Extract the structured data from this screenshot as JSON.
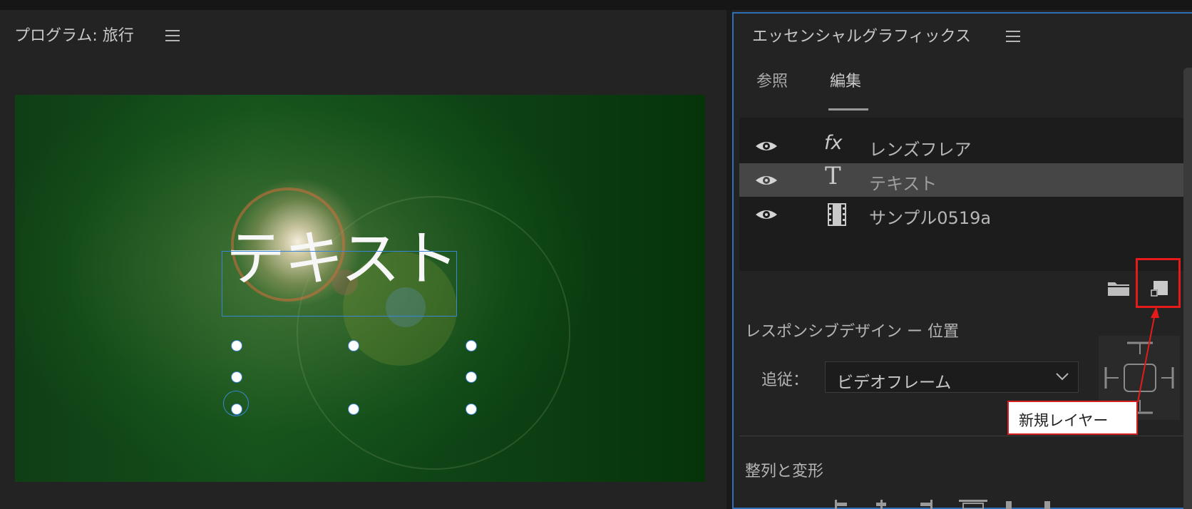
{
  "program_monitor": {
    "title": "プログラム: 旅行",
    "video_text": "テキスト"
  },
  "essential_graphics": {
    "title": "エッセンシャルグラフィックス",
    "tabs": [
      {
        "label": "参照",
        "active": false
      },
      {
        "label": "編集",
        "active": true
      }
    ],
    "layers": [
      {
        "type": "fx",
        "type_icon": "fx-icon",
        "name": "レンズフレア",
        "selected": false
      },
      {
        "type": "T",
        "type_icon": "text-icon",
        "name": "テキスト",
        "selected": true
      },
      {
        "type": "",
        "type_icon": "film-icon",
        "name": "サンプル0519a",
        "selected": false
      }
    ],
    "responsive_design_title": "レスポンシブデザイン ー 位置",
    "follow_label": "追従：",
    "follow_value": "ビデオフレーム",
    "align_transform_title": "整列と変形"
  },
  "annotation": {
    "tooltip": "新規レイヤー",
    "highlight_color": "#e51b1b"
  },
  "colors": {
    "panel_bg": "#232323",
    "active_panel_border": "#2e6fb6",
    "selection_box": "#3a86d6"
  }
}
